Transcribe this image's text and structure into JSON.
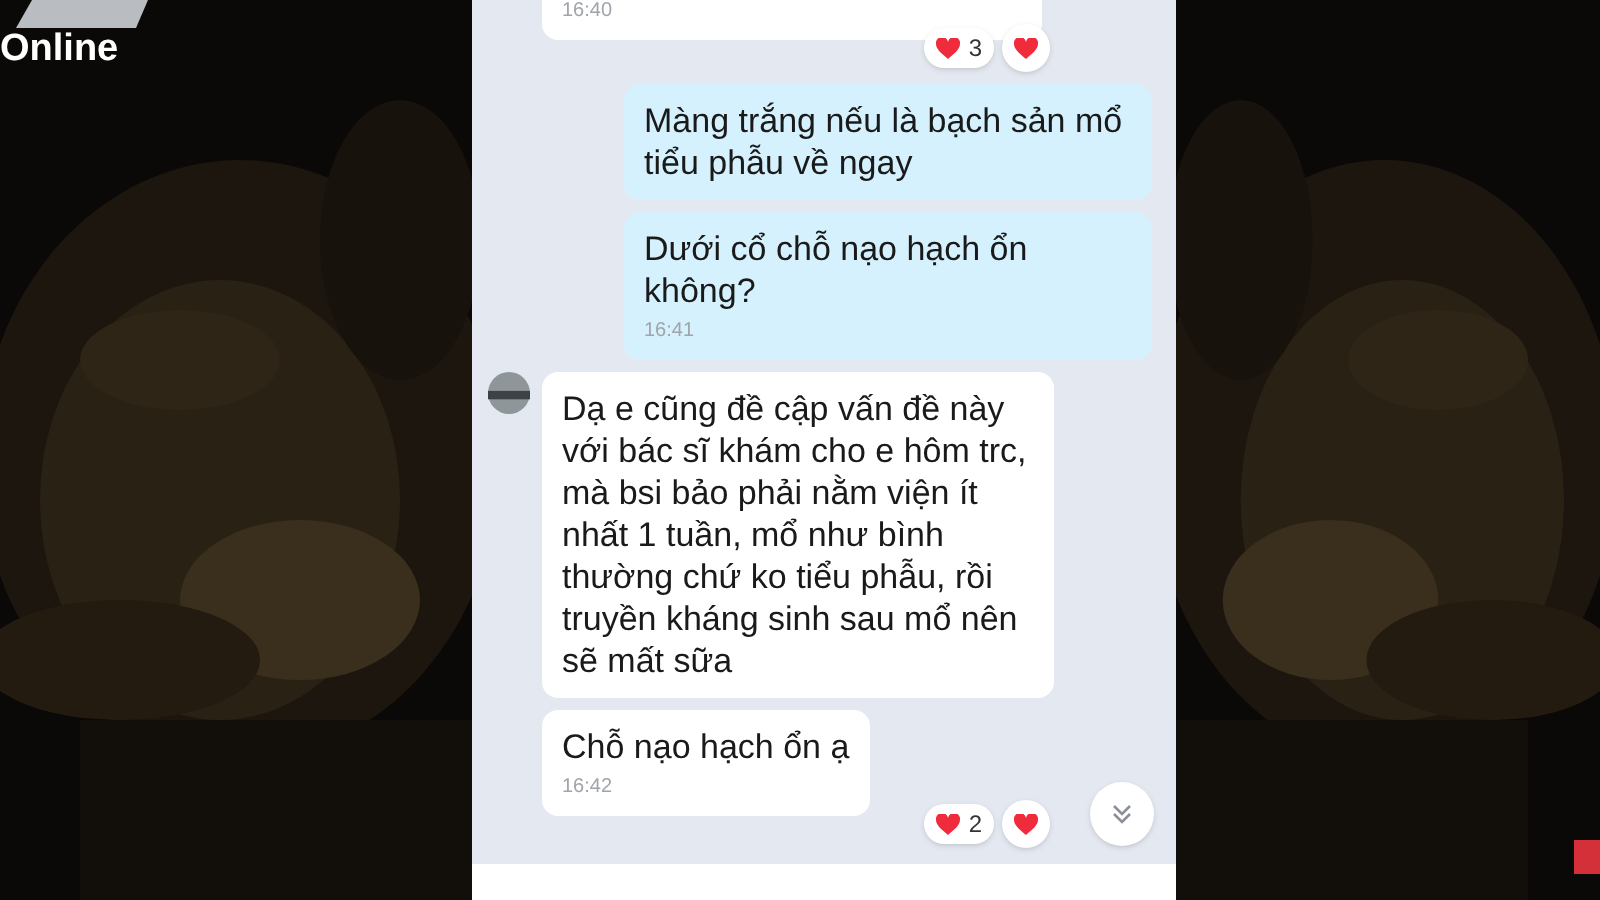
{
  "channel": {
    "logo_text": "Online"
  },
  "chat": {
    "messages": [
      {
        "kind": "incoming",
        "avatar": false,
        "time": "16:40",
        "reaction_count": "3"
      },
      {
        "kind": "outgoing",
        "text": "Màng trắng nếu là bạch sản mổ tiểu phẫu về ngay"
      },
      {
        "kind": "outgoing",
        "text": "Dưới cổ chỗ nạo hạch ổn không?",
        "time": "16:41"
      },
      {
        "kind": "incoming",
        "avatar": true,
        "text": "Dạ e cũng đề cập vấn đề này với bác sĩ khám cho e hôm trc, mà bsi bảo phải nằm viện ít nhất 1 tuần, mổ như bình thường chứ ko tiểu phẫu, rồi truyền kháng sinh sau mổ nên sẽ mất sữa"
      },
      {
        "kind": "incoming",
        "avatar": false,
        "text": "Chỗ nạo hạch ổn ạ",
        "time": "16:42",
        "reaction_count": "2"
      }
    ]
  }
}
